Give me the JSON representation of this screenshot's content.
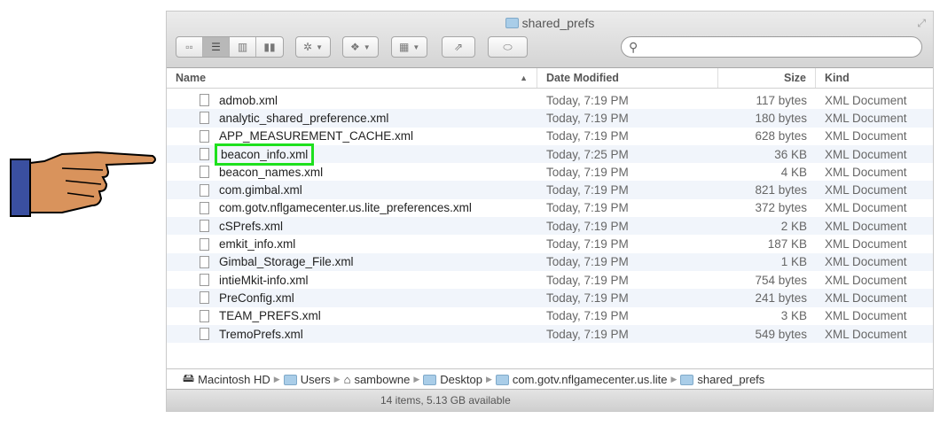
{
  "window": {
    "title": "shared_prefs"
  },
  "search": {
    "placeholder": ""
  },
  "columns": {
    "name": "Name",
    "date": "Date Modified",
    "size": "Size",
    "kind": "Kind"
  },
  "files": [
    {
      "name": "admob.xml",
      "date": "Today, 7:19 PM",
      "size": "117 bytes",
      "kind": "XML Document"
    },
    {
      "name": "analytic_shared_preference.xml",
      "date": "Today, 7:19 PM",
      "size": "180 bytes",
      "kind": "XML Document"
    },
    {
      "name": "APP_MEASUREMENT_CACHE.xml",
      "date": "Today, 7:19 PM",
      "size": "628 bytes",
      "kind": "XML Document"
    },
    {
      "name": "beacon_info.xml",
      "date": "Today, 7:25 PM",
      "size": "36 KB",
      "kind": "XML Document",
      "highlighted": true
    },
    {
      "name": "beacon_names.xml",
      "date": "Today, 7:19 PM",
      "size": "4 KB",
      "kind": "XML Document"
    },
    {
      "name": "com.gimbal.xml",
      "date": "Today, 7:19 PM",
      "size": "821 bytes",
      "kind": "XML Document"
    },
    {
      "name": "com.gotv.nflgamecenter.us.lite_preferences.xml",
      "date": "Today, 7:19 PM",
      "size": "372 bytes",
      "kind": "XML Document"
    },
    {
      "name": "cSPrefs.xml",
      "date": "Today, 7:19 PM",
      "size": "2 KB",
      "kind": "XML Document"
    },
    {
      "name": "emkit_info.xml",
      "date": "Today, 7:19 PM",
      "size": "187 KB",
      "kind": "XML Document"
    },
    {
      "name": "Gimbal_Storage_File.xml",
      "date": "Today, 7:19 PM",
      "size": "1 KB",
      "kind": "XML Document"
    },
    {
      "name": "intieMkit-info.xml",
      "date": "Today, 7:19 PM",
      "size": "754 bytes",
      "kind": "XML Document"
    },
    {
      "name": "PreConfig.xml",
      "date": "Today, 7:19 PM",
      "size": "241 bytes",
      "kind": "XML Document"
    },
    {
      "name": "TEAM_PREFS.xml",
      "date": "Today, 7:19 PM",
      "size": "3 KB",
      "kind": "XML Document"
    },
    {
      "name": "TremoPrefs.xml",
      "date": "Today, 7:19 PM",
      "size": "549 bytes",
      "kind": "XML Document"
    }
  ],
  "path": [
    "Macintosh HD",
    "Users",
    "sambowne",
    "Desktop",
    "com.gotv.nflgamecenter.us.lite",
    "shared_prefs"
  ],
  "status": "14 items, 5.13 GB available",
  "colors": {
    "highlight": "#1ee01e"
  }
}
